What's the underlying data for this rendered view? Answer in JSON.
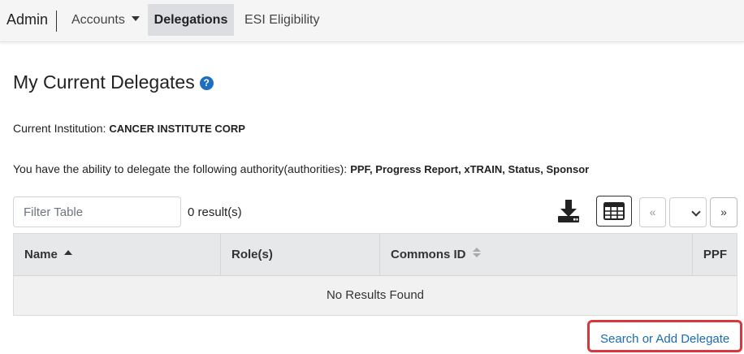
{
  "nav": {
    "brand": "Admin",
    "items": [
      {
        "label": "Accounts"
      },
      {
        "label": "Delegations"
      },
      {
        "label": "ESI Eligibility"
      }
    ]
  },
  "page": {
    "title": "My Current Delegates",
    "help_icon": "?"
  },
  "institution": {
    "label": "Current Institution:",
    "value": "CANCER INSTITUTE CORP"
  },
  "authorities": {
    "label": "You have the ability to delegate the following authority(authorities):",
    "value": "PPF, Progress Report, xTRAIN, Status, Sponsor"
  },
  "table_controls": {
    "filter_placeholder": "Filter Table",
    "result_count": "0 result(s)",
    "prev_label": "«",
    "next_label": "»",
    "icons": [
      "download-icon",
      "table-grid-icon"
    ]
  },
  "table": {
    "columns": [
      "Name",
      "Role(s)",
      "Commons ID",
      "PPF"
    ],
    "empty_message": "No Results Found"
  },
  "actions": {
    "add_delegate": "Search or Add Delegate"
  },
  "colors": {
    "link": "#1a6ab5",
    "highlight_border": "#d9363e",
    "help_icon": "#1e6fbf"
  }
}
